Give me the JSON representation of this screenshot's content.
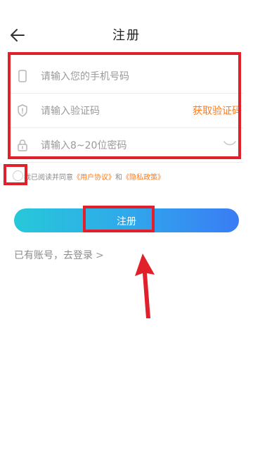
{
  "header": {
    "back_icon": "arrow-left-icon",
    "title": "注册"
  },
  "form": {
    "phone": {
      "icon": "phone-icon",
      "placeholder": "请输入您的手机号码",
      "value": ""
    },
    "code": {
      "icon": "shield-icon",
      "placeholder": "请输入验证码",
      "value": "",
      "get_code_label": "获取验证码"
    },
    "password": {
      "icon": "lock-icon",
      "placeholder": "请输入8~20位密码",
      "value": "",
      "toggle_icon": "eye-closed-icon"
    }
  },
  "agreement": {
    "prefix": "我已阅读并同意",
    "user_agreement": "《用户协议》",
    "and": "和",
    "privacy_policy": "《隐私政策》",
    "checked": false
  },
  "register_button": {
    "label": "注册"
  },
  "login_link": {
    "label": "已有账号，去登录",
    "chevron": ">"
  },
  "colors": {
    "accent_orange": "#ff7a1a",
    "annotation_red": "#e0202a",
    "button_gradient_start": "#27c8d9",
    "button_gradient_end": "#3a7cf6"
  }
}
